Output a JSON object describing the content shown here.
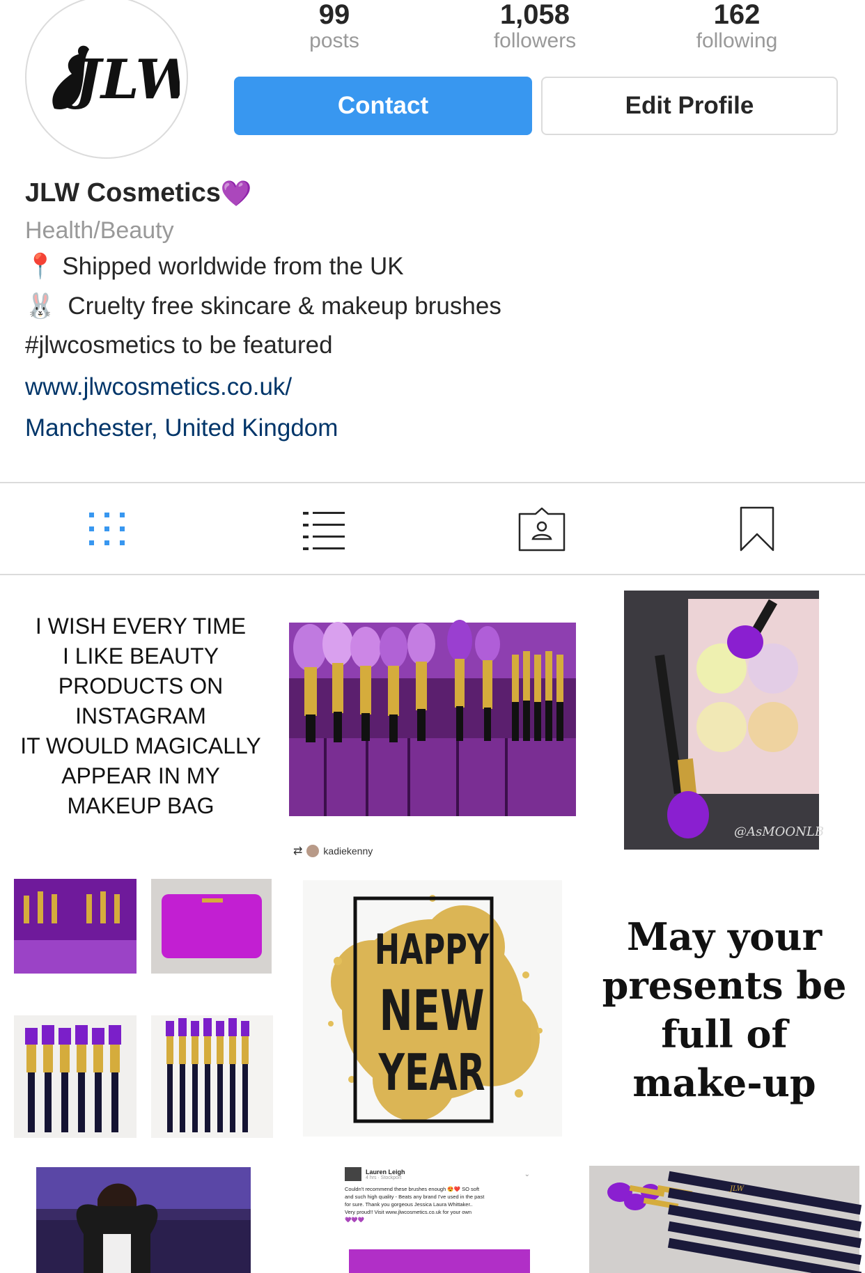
{
  "profile": {
    "avatar_text": "JLW",
    "stats": [
      {
        "count": "99",
        "label": "posts"
      },
      {
        "count": "1,058",
        "label": "followers"
      },
      {
        "count": "162",
        "label": "following"
      }
    ],
    "contact_label": "Contact",
    "edit_label": "Edit Profile"
  },
  "bio": {
    "name": "JLW Cosmetics",
    "name_emoji": "💜",
    "category": "Health/Beauty",
    "line1_emoji": "📍",
    "line1": "Shipped worldwide from the UK",
    "line2_emoji": "🐰",
    "line2": "Cruelty free skincare & makeup brushes",
    "line3": "#jlwcosmetics to be featured",
    "website": "www.jlwcosmetics.co.uk/",
    "location": "Manchester, United Kingdom"
  },
  "tabs": [
    "grid-icon",
    "list-icon",
    "tagged-icon",
    "saved-icon"
  ],
  "colors": {
    "accent": "#3897f0",
    "link": "#003569",
    "purple": "#8b1fd6",
    "gold": "#c9a13b"
  },
  "posts": {
    "quote1": [
      "I WISH EVERY TIME",
      "I LIKE BEAUTY",
      "PRODUCTS ON",
      "INSTAGRAM",
      "IT WOULD MAGICALLY",
      "APPEAR IN MY",
      "MAKEUP BAG"
    ],
    "repost_user": "kadiekenny",
    "signature": "@AsMOONLB",
    "newyear": [
      "HAPPY",
      "NEW",
      "YEAR"
    ],
    "quote2": [
      "May your",
      "presents be",
      "full of",
      "make-up"
    ],
    "review": {
      "author": "Lauren Leigh",
      "meta": "4 hrs · Stockport",
      "lines": [
        "Couldn't recommend these brushes enough 😍❤️ SO soft",
        "and such high quality - Beats any brand I've used in the past",
        "for sure. Thank you gorgeous Jessica Laura Whittaker..",
        "Very proud!! Visit www.jlwcosmetics.co.uk for your own",
        "💜💜💜"
      ]
    },
    "brush_mark": "JLW"
  }
}
